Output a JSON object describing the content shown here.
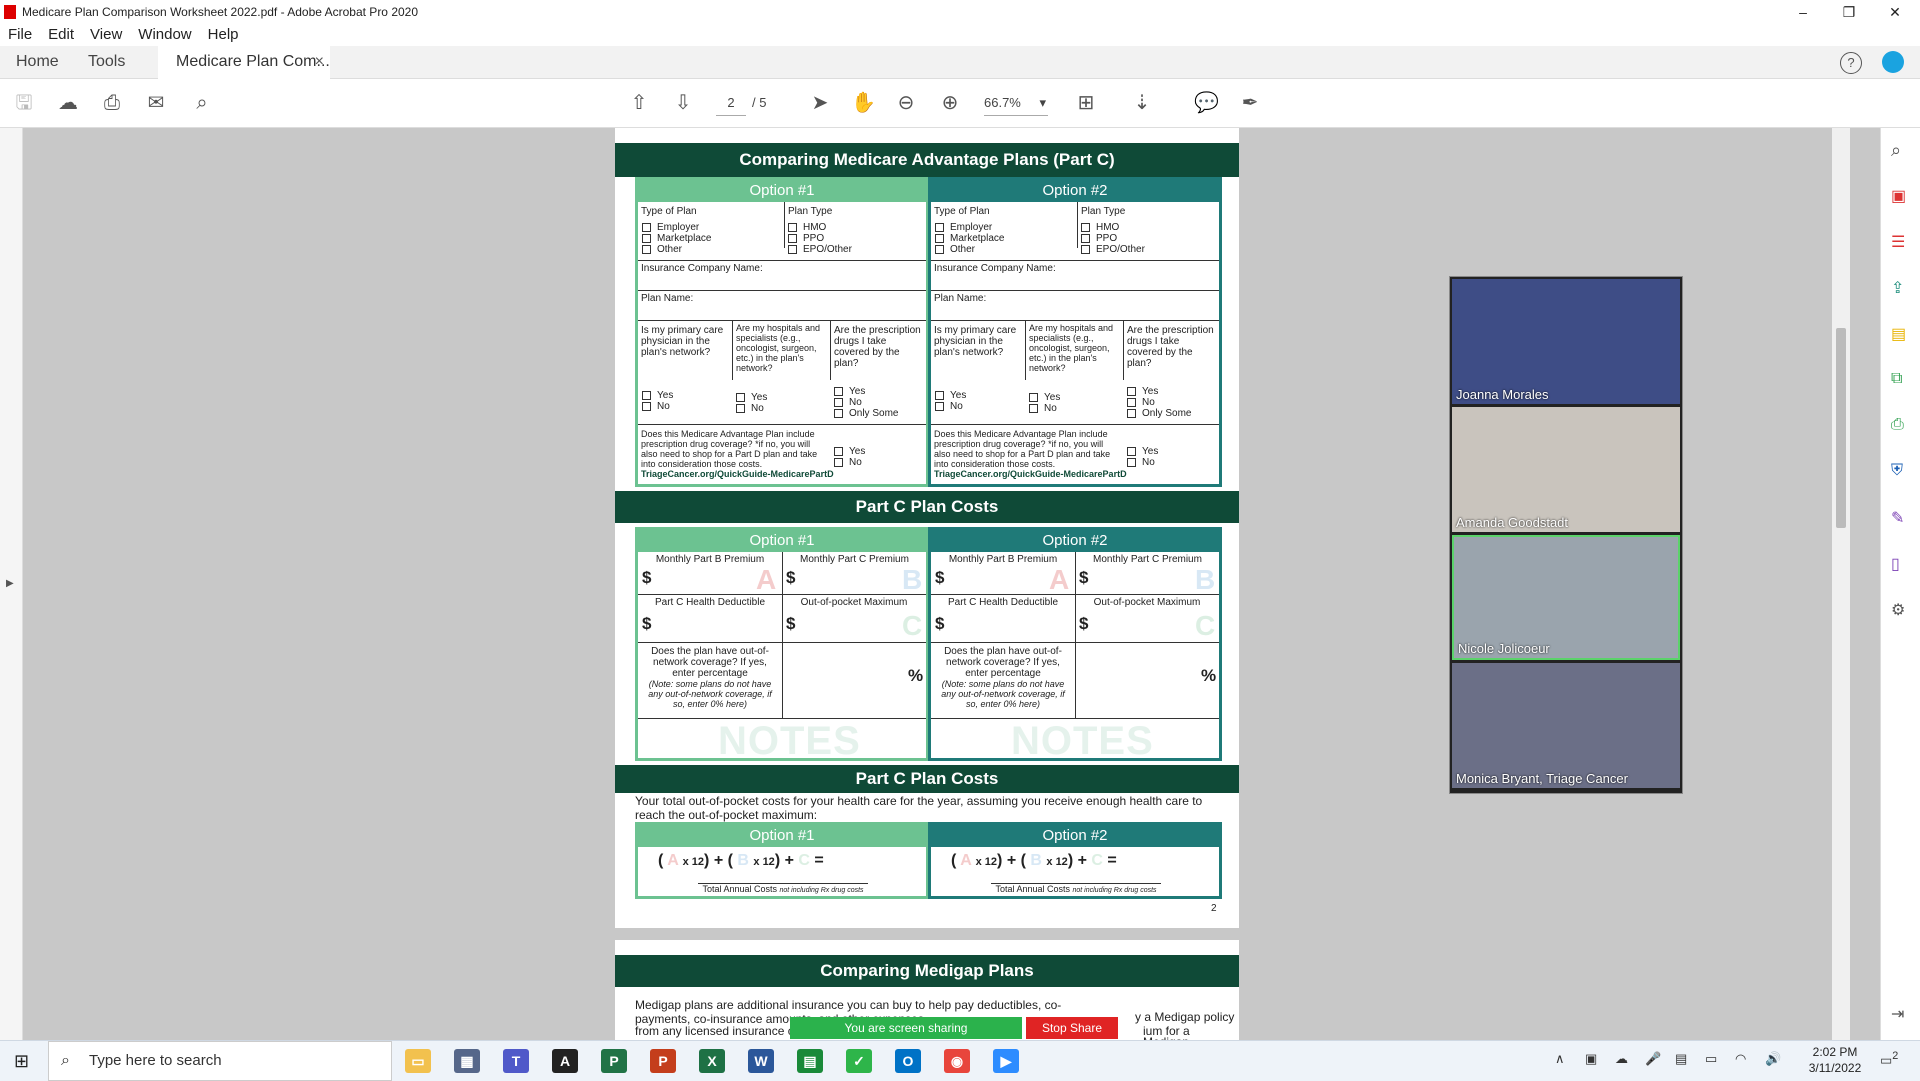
{
  "window": {
    "title": "Medicare Plan Comparison Worksheet 2022.pdf - Adobe Acrobat Pro 2020"
  },
  "menu": [
    "File",
    "Edit",
    "View",
    "Window",
    "Help"
  ],
  "tabs": {
    "home": "Home",
    "tools": "Tools",
    "doc": "Medicare Plan Com...",
    "close": "×"
  },
  "toolbar": {
    "page_current": "2",
    "page_total": "/ 5",
    "zoom": "66.7%"
  },
  "pdf": {
    "section1_title": "Comparing Medicare Advantage Plans (Part C)",
    "option1": "Option #1",
    "option2": "Option #2",
    "type_of_plan": "Type of Plan",
    "plan_type": "Plan Type",
    "type_options": [
      "Employer",
      "Marketplace",
      "Other"
    ],
    "plan_options": [
      "HMO",
      "PPO",
      "EPO/Other"
    ],
    "insurance_company": "Insurance Company Name:",
    "plan_name": "Plan Name:",
    "q_pcp": "Is my primary care physician in the plan's network?",
    "q_hospitals": "Are my hospitals and specialists (e.g., oncologist, surgeon, etc.) in the plan's network?",
    "q_drugs": "Are the prescription drugs I take covered by the plan?",
    "yes": "Yes",
    "no": "No",
    "only_some": "Only Some",
    "q_drug_coverage": "Does this Medicare Advantage Plan include prescription drug coverage? *if no, you will also need to shop for a Part D plan and take into consideration those costs.",
    "link": "TriageCancer.org/QuickGuide-MedicarePartD",
    "section2_title": "Part C Plan Costs",
    "monthly_b": "Monthly Part B Premium",
    "monthly_c": "Monthly Part C Premium",
    "deductible": "Part C Health Deductible",
    "oop_max": "Out-of-pocket Maximum",
    "dollar": "$",
    "letter_a": "A",
    "letter_b": "B",
    "letter_c": "C",
    "oon_q": "Does the plan have out-of-network coverage? If yes, enter percentage",
    "oon_note": "(Note: some plans do not have any out-of-network coverage, if so, enter 0% here)",
    "percent": "%",
    "notes": "NOTES",
    "section3_title": "Part C Plan Costs",
    "section3_text": "Your total out-of-pocket costs for your health care for the year, assuming you receive enough health care to reach the out-of-pocket maximum:",
    "formula_x12": "x 12",
    "formula_plus": "+",
    "formula_eq": "=",
    "total_label": "Total Annual Costs",
    "total_note": "not including Rx drug costs",
    "page_num": "2",
    "section4_title": "Comparing Medigap Plans",
    "section4_text": "Medigap plans are additional insurance you can buy to help pay deductibles, co-payments, co-insurance amounts, and other expenses",
    "section4_text_b": "y a Medigap policy",
    "section4_text_c": "from any licensed insurance c",
    "section4_text_d": "ium for a Medigap"
  },
  "sharing": {
    "text": "You are screen sharing",
    "stop": "Stop Share"
  },
  "participants": [
    "Joanna Morales",
    "Amanda Goodstadt",
    "Nicole Jolicoeur",
    "Monica Bryant, Triage Cancer"
  ],
  "taskbar": {
    "search_placeholder": "Type here to search",
    "time": "2:02 PM",
    "date": "3/11/2022",
    "notifications": "2"
  }
}
